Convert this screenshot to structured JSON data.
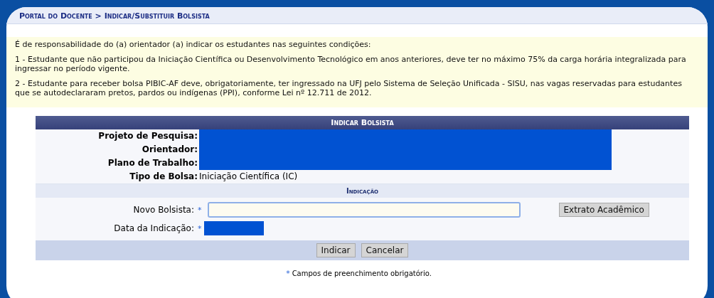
{
  "breadcrumb": "Portal do Docente > Indicar/Substituir Bolsista",
  "notice": {
    "intro": "É de responsabilidade do (a) orientador (a) indicar os estudantes nas seguintes condições:",
    "items": [
      "1 - Estudante que não participou da Iniciação Científica ou Desenvolvimento Tecnológico em anos anteriores, deve ter no máximo 75% da carga horária integralizada para ingressar no período vigente.",
      "2 - Estudante para receber bolsa PIBIC-AF deve, obrigatoriamente, ter ingressado na UFJ pelo Sistema de Seleção Unificada - SISU, nas vagas reservadas para estudantes que se autodeclararam pretos, pardos ou indígenas (PPI), conforme Lei nº 12.711 de 2012."
    ]
  },
  "form": {
    "title": "Indicar Bolsista",
    "info_rows": [
      {
        "label": "Projeto de Pesquisa:",
        "kind": "redacted"
      },
      {
        "label": "Orientador:",
        "kind": "redacted"
      },
      {
        "label": "Plano de Trabalho:",
        "kind": "redacted"
      },
      {
        "label": "Tipo de Bolsa:",
        "kind": "text",
        "value": "Iniciação Científica (IC)"
      }
    ],
    "section_title": "Indicação",
    "fields": [
      {
        "label": "Novo Bolsista:",
        "required_mark": "*",
        "kind": "input",
        "side_button": "Extrato Acadêmico"
      },
      {
        "label": "Data da Indicação:",
        "required_mark": "*",
        "kind": "redacted"
      }
    ],
    "buttons": [
      "Indicar",
      "Cancelar"
    ]
  },
  "footer": {
    "mark": "*",
    "text": "Campos de preenchimento obrigatório."
  }
}
